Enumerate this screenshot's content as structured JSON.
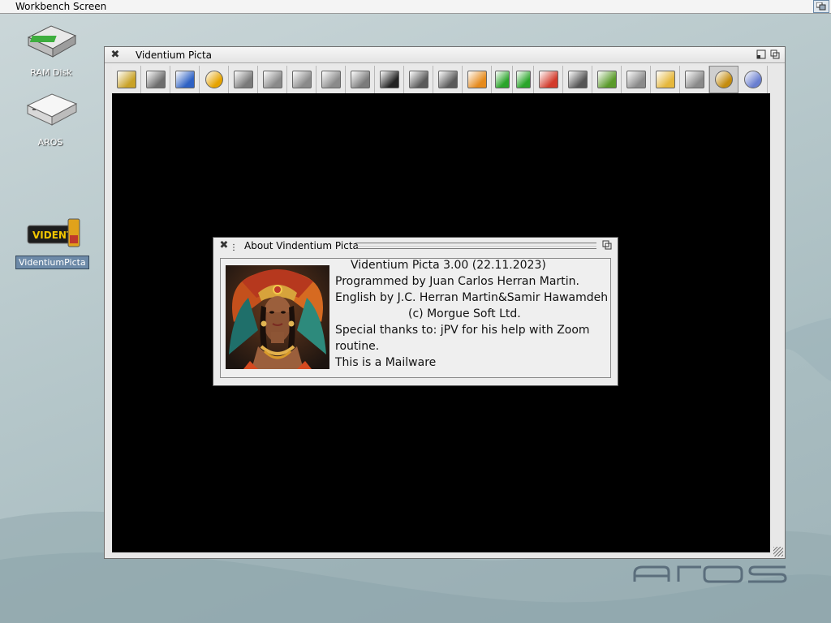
{
  "screen": {
    "title": "Workbench Screen"
  },
  "desktop": {
    "icons": [
      {
        "label": "RAM Disk"
      },
      {
        "label": "AROS"
      },
      {
        "label": "VidentiumPicta",
        "badge_text": "VIDENTI"
      }
    ]
  },
  "main_window": {
    "title": "Videntium Picta",
    "toolbar": [
      {
        "name": "open-icon",
        "color": "#c9a227"
      },
      {
        "name": "save-icon",
        "color": "#6d6d6d"
      },
      {
        "name": "fit-icon",
        "color": "#2f62c4"
      },
      {
        "name": "help-question-icon",
        "color": "#e6a300"
      },
      {
        "name": "rotate-icon",
        "color": "#7a7a7a"
      },
      {
        "name": "image-info-icon",
        "color": "#8a8a8a"
      },
      {
        "name": "rotate-90-icon",
        "color": "#8a8a8a"
      },
      {
        "name": "scale-percent-icon",
        "color": "#8a8a8a"
      },
      {
        "name": "magnify-icon",
        "color": "#7b7b7b"
      },
      {
        "name": "filmstrip-icon",
        "color": "#222222"
      },
      {
        "name": "zoom-out-icon",
        "color": "#5a5a5a"
      },
      {
        "name": "zoom-in-icon",
        "color": "#5a5a5a"
      },
      {
        "name": "undo-icon",
        "color": "#e58a1c"
      },
      {
        "name": "arrow-left-icon",
        "color": "#2aa52a"
      },
      {
        "name": "arrow-right-icon",
        "color": "#2aa52a"
      },
      {
        "name": "delete-icon",
        "color": "#d23b2b"
      },
      {
        "name": "convert-icon",
        "color": "#555555"
      },
      {
        "name": "export-icon",
        "color": "#5a9a2a"
      },
      {
        "name": "copy-icon",
        "color": "#8a8a8a"
      },
      {
        "name": "folder-icon",
        "color": "#e5b73b"
      },
      {
        "name": "slideshow-icon",
        "color": "#8a8a8a"
      },
      {
        "name": "info-icon",
        "color": "#c48c0e"
      },
      {
        "name": "help-icon",
        "color": "#6a7fd0"
      }
    ]
  },
  "about_window": {
    "title": "About Vindentium Picta",
    "lines": [
      "Videntium Picta 3.00 (22.11.2023)",
      "Programmed by Juan Carlos Herran Martin.",
      "English by J.C. Herran Martin&Samir Hawamdeh",
      "(c) Morgue Soft Ltd.",
      "Special thanks to: jPV for his help with Zoom",
      "routine.",
      "This is a Mailware"
    ]
  },
  "logo": {
    "text": "aros"
  }
}
